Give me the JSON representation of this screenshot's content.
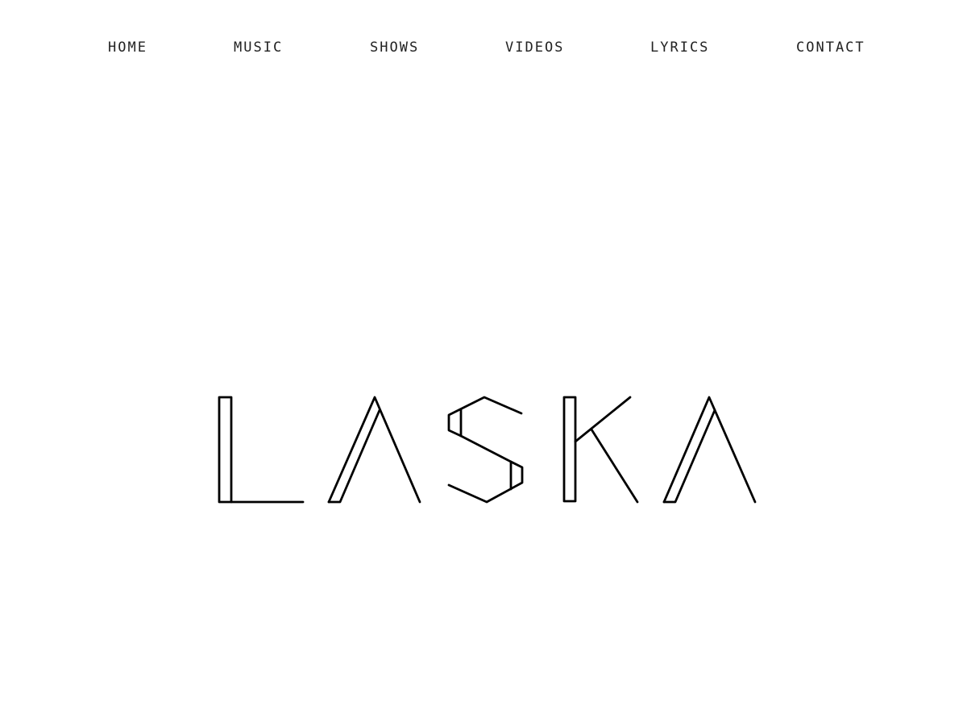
{
  "nav": {
    "items": [
      {
        "label": "HOME"
      },
      {
        "label": "MUSIC"
      },
      {
        "label": "SHOWS"
      },
      {
        "label": "VIDEOS"
      },
      {
        "label": "LYRICS"
      },
      {
        "label": "CONTACT"
      }
    ]
  },
  "logo": {
    "text": "LASKA"
  }
}
